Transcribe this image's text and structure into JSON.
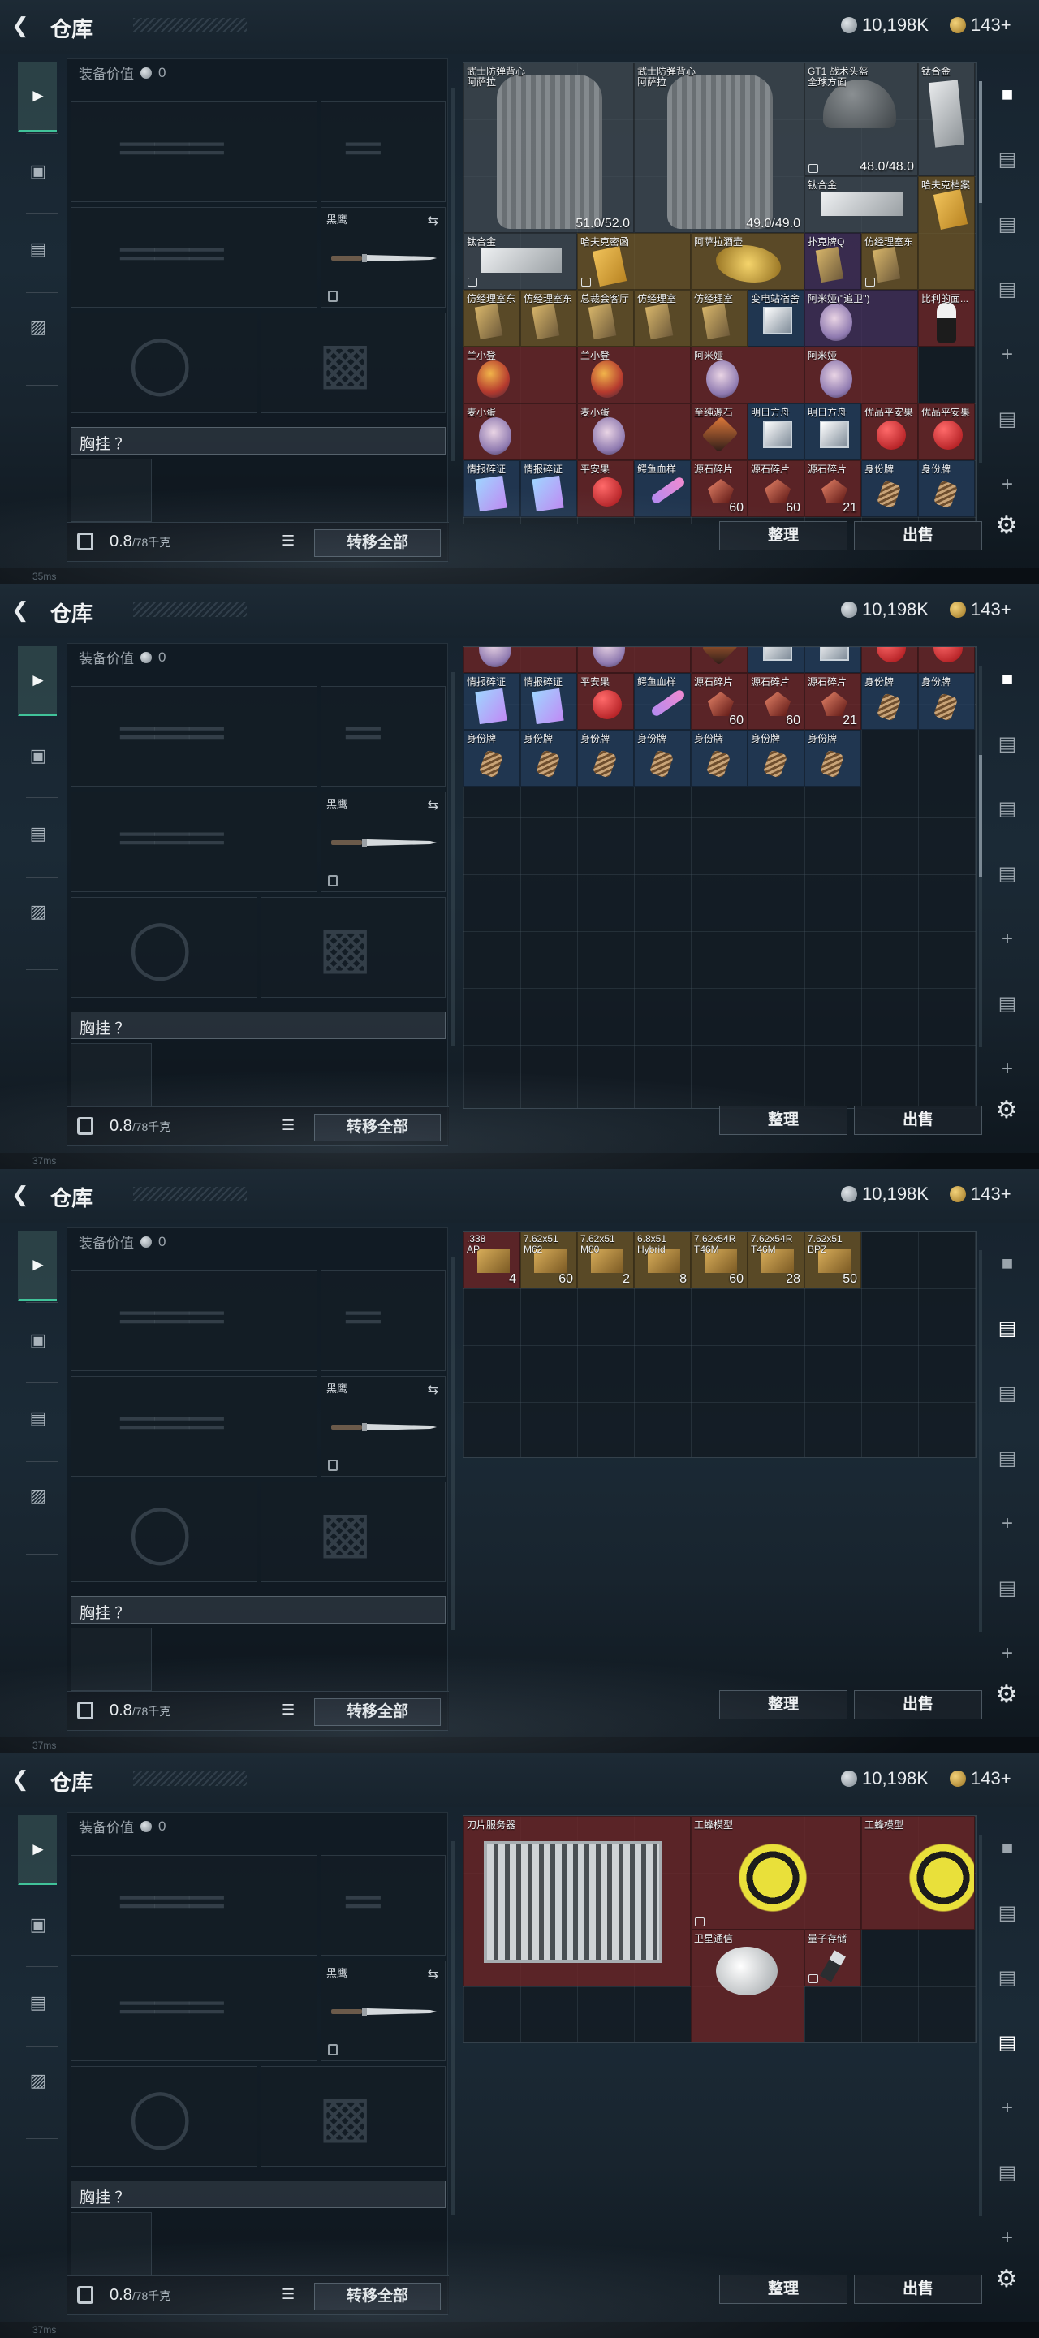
{
  "header": {
    "title": "仓库",
    "silver_amount": "10,198K",
    "gold_amount": "143+"
  },
  "equipment": {
    "value_label": "装备价值",
    "value_amount": "0",
    "knife_name": "黑鹰",
    "chest_label": "胸挂 ？",
    "weight": "0.8",
    "weight_capacity": "/78千克",
    "transfer_all_label": "转移全部"
  },
  "actions": {
    "sort_label": "整理",
    "sell_label": "出售"
  },
  "status": {
    "ping_labels": [
      "35ms",
      "37ms",
      "37ms",
      "37ms"
    ]
  },
  "panel1_items": [
    {
      "name": "武士防弹背心",
      "name2": "阿萨拉",
      "count": "51.0/52.0"
    },
    {
      "name": "武士防弹背心",
      "name2": "阿萨拉",
      "count": "49.0/49.0"
    },
    {
      "name": "GT1 战术头盔",
      "name2": "全球方面",
      "count": "48.0/48.0"
    },
    {
      "name": "钛合金",
      "name2": "",
      "count": ""
    },
    {
      "name": "钛合金",
      "name2": "",
      "count": ""
    },
    {
      "name": "哈夫克档案",
      "name2": "",
      "count": ""
    },
    {
      "name": "钛合金",
      "name2": "",
      "count": ""
    },
    {
      "name": "哈夫克密函",
      "name2": "",
      "count": ""
    },
    {
      "name": "阿萨拉酒壶",
      "name2": "",
      "count": ""
    },
    {
      "name": "扑克牌Q",
      "name2": "",
      "count": ""
    },
    {
      "name": "仿经理室东",
      "name2": "",
      "count": ""
    },
    {
      "name": "仿经理室东",
      "name2": "",
      "count": ""
    },
    {
      "name": "仿经理室东",
      "name2": "",
      "count": ""
    },
    {
      "name": "总裁会客厅",
      "name2": "",
      "count": ""
    },
    {
      "name": "仿经理室",
      "name2": "",
      "count": ""
    },
    {
      "name": "仿经理室",
      "name2": "",
      "count": ""
    },
    {
      "name": "变电站宿舍",
      "name2": "",
      "count": ""
    },
    {
      "name": "阿米娅(\"追卫\")",
      "name2": "",
      "count": ""
    },
    {
      "name": "比利的面...",
      "name2": "",
      "count": ""
    },
    {
      "name": "兰小登",
      "name2": "",
      "count": ""
    },
    {
      "name": "兰小登",
      "name2": "",
      "count": ""
    },
    {
      "name": "阿米娅",
      "name2": "",
      "count": ""
    },
    {
      "name": "阿米娅",
      "name2": "",
      "count": ""
    },
    {
      "name": "麦小蛋",
      "name2": "",
      "count": ""
    },
    {
      "name": "麦小蛋",
      "name2": "",
      "count": ""
    },
    {
      "name": "至纯源石",
      "name2": "",
      "count": ""
    },
    {
      "name": "明日方舟",
      "name2": "",
      "count": ""
    },
    {
      "name": "明日方舟",
      "name2": "",
      "count": ""
    },
    {
      "name": "优品平安果",
      "name2": "",
      "count": ""
    },
    {
      "name": "优品平安果",
      "name2": "",
      "count": ""
    },
    {
      "name": "情报碎证",
      "name2": "",
      "count": ""
    },
    {
      "name": "情报碎证",
      "name2": "",
      "count": ""
    },
    {
      "name": "平安果",
      "name2": "",
      "count": ""
    },
    {
      "name": "鳄鱼血样",
      "name2": "",
      "count": ""
    },
    {
      "name": "源石碎片",
      "name2": "",
      "count": "60"
    },
    {
      "name": "源石碎片",
      "name2": "",
      "count": "60"
    },
    {
      "name": "源石碎片",
      "name2": "",
      "count": "21"
    },
    {
      "name": "身份牌",
      "name2": "",
      "count": ""
    },
    {
      "name": "身份牌",
      "name2": "",
      "count": ""
    }
  ],
  "panel2_items": [
    {
      "name": "麦小蛋",
      "count": ""
    },
    {
      "name": "麦小蛋",
      "count": ""
    },
    {
      "name": "至纯源石",
      "count": ""
    },
    {
      "name": "明日方舟",
      "count": ""
    },
    {
      "name": "明日方舟",
      "count": ""
    },
    {
      "name": "优品平安果",
      "count": ""
    },
    {
      "name": "优品平安果",
      "count": ""
    },
    {
      "name": "情报碎证",
      "count": ""
    },
    {
      "name": "情报碎证",
      "count": ""
    },
    {
      "name": "平安果",
      "count": ""
    },
    {
      "name": "鳄鱼血样",
      "count": ""
    },
    {
      "name": "源石碎片",
      "count": "60"
    },
    {
      "name": "源石碎片",
      "count": "60"
    },
    {
      "name": "源石碎片",
      "count": "21"
    },
    {
      "name": "身份牌",
      "count": ""
    },
    {
      "name": "身份牌",
      "count": ""
    },
    {
      "name": "身份牌",
      "count": ""
    },
    {
      "name": "身份牌",
      "count": ""
    },
    {
      "name": "身份牌",
      "count": ""
    },
    {
      "name": "身份牌",
      "count": ""
    },
    {
      "name": "身份牌",
      "count": ""
    },
    {
      "name": "身份牌",
      "count": ""
    },
    {
      "name": "身份牌",
      "count": ""
    },
    {
      "name": "身份牌",
      "count": ""
    }
  ],
  "panel3_items": [
    {
      "name": ".338",
      "name2": "AP",
      "count": "4"
    },
    {
      "name": "7.62x51",
      "name2": "M62",
      "count": "60"
    },
    {
      "name": "7.62x51",
      "name2": "M80",
      "count": "2"
    },
    {
      "name": "6.8x51",
      "name2": "Hybrid",
      "count": "8"
    },
    {
      "name": "7.62x54R",
      "name2": "T46M",
      "count": "60"
    },
    {
      "name": "7.62x54R",
      "name2": "T46M",
      "count": "28"
    },
    {
      "name": "7.62x51",
      "name2": "BPZ",
      "count": "50"
    }
  ],
  "panel4_items": [
    {
      "name": "刀片服务器"
    },
    {
      "name": "工蜂模型"
    },
    {
      "name": "工蜂模型"
    },
    {
      "name": "卫星通信"
    },
    {
      "name": "量子存储"
    }
  ]
}
